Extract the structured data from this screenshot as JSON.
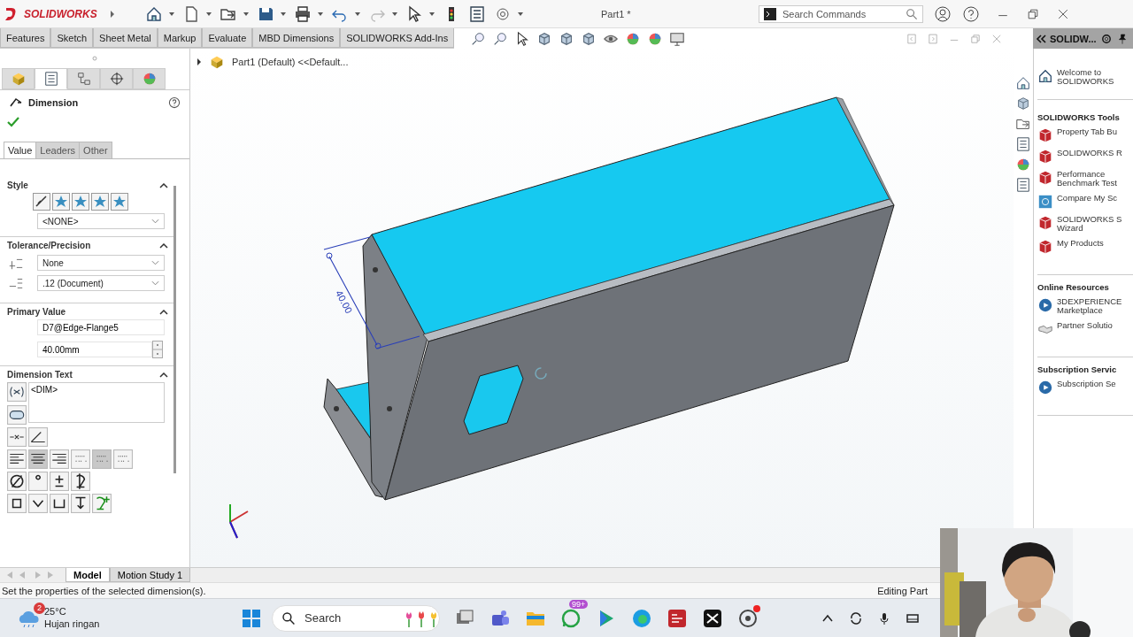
{
  "app": {
    "brand": "SOLIDWORKS",
    "document_title": "Part1 *",
    "search": {
      "placeholder": "Search Commands"
    }
  },
  "command_tabs": [
    "Features",
    "Sketch",
    "Sheet Metal",
    "Markup",
    "Evaluate",
    "MBD Dimensions",
    "SOLIDWORKS Add-Ins"
  ],
  "property_manager": {
    "title": "Dimension",
    "tabs": [
      {
        "label": "Value",
        "selected": true
      },
      {
        "label": "Leaders",
        "selected": false
      },
      {
        "label": "Other",
        "selected": false
      }
    ],
    "style": {
      "heading": "Style",
      "value": "<NONE>"
    },
    "tolerance": {
      "heading": "Tolerance/Precision",
      "type": "None",
      "precision": ".12 (Document)"
    },
    "primary_value": {
      "heading": "Primary Value",
      "name": "D7@Edge-Flange5",
      "value": "40.00mm"
    },
    "dimension_text": {
      "heading": "Dimension Text",
      "value": "<DIM>"
    }
  },
  "feature_tree": {
    "root": "Part1 (Default) <<Default..."
  },
  "viewport": {
    "dimension_value": "40.00"
  },
  "task_pane": {
    "header": "SOLIDW...",
    "welcome": "Welcome to SOLIDWORKS",
    "sections": [
      {
        "heading": "SOLIDWORKS Tools",
        "items": [
          "Property Tab Bu",
          "SOLIDWORKS R",
          "Performance Benchmark Test",
          "Compare My Sc",
          "SOLIDWORKS S Wizard",
          "My Products"
        ]
      },
      {
        "heading": "Online Resources",
        "items": [
          "3DEXPERIENCE Marketplace",
          "Partner Solutio"
        ]
      },
      {
        "heading": "Subscription Servic",
        "items": [
          "Subscription Se"
        ]
      }
    ]
  },
  "model_tabs": [
    {
      "label": "Model",
      "selected": true
    },
    {
      "label": "Motion Study 1",
      "selected": false
    }
  ],
  "status_bar": {
    "message": "Set the properties of the selected dimension(s).",
    "mode": "Editing Part"
  },
  "taskbar": {
    "weather": {
      "alert_count": "2",
      "temperature": "25°C",
      "condition": "Hujan ringan"
    },
    "search": {
      "placeholder": "Search"
    },
    "messaging_badge": "99+"
  }
}
